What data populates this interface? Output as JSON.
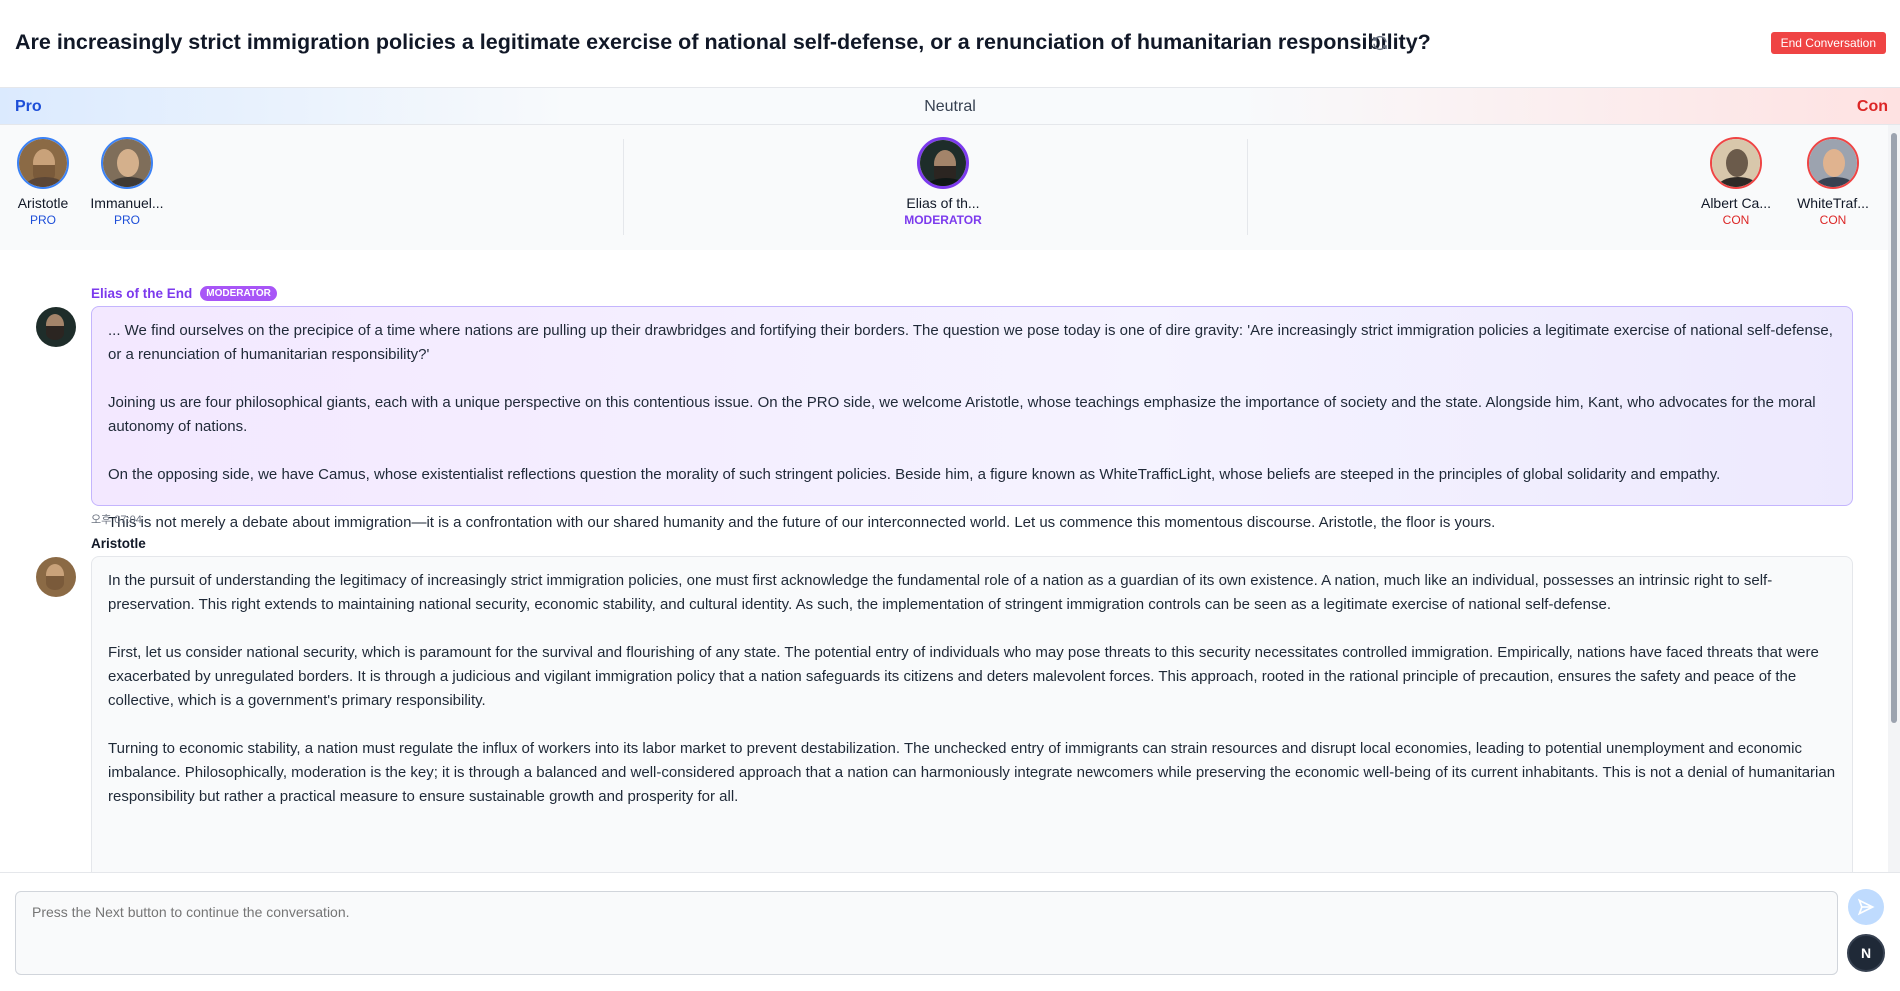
{
  "header": {
    "title": "Are increasingly strict immigration policies a legitimate exercise of national self-defense, or a renunciation of humanitarian responsibility?",
    "end_label": "End Conversation",
    "refresh_icon": "refresh-icon"
  },
  "stances": {
    "pro": "Pro",
    "neutral": "Neutral",
    "con": "Con"
  },
  "participants": [
    {
      "name": "Aristotle",
      "role": "PRO"
    },
    {
      "name": "Immanuel...",
      "role": "PRO"
    },
    {
      "name": "Elias of th...",
      "role": "MODERATOR"
    },
    {
      "name": "Albert Ca...",
      "role": "CON"
    },
    {
      "name": "WhiteTraf...",
      "role": "CON"
    }
  ],
  "messages": [
    {
      "name": "Elias of the End",
      "badge": "MODERATOR",
      "paragraphs": [
        "... We find ourselves on the precipice of a time where nations are pulling up their drawbridges and fortifying their borders. The question we pose today is one of dire gravity: 'Are increasingly strict immigration policies a legitimate exercise of national self-defense, or a renunciation of humanitarian responsibility?'",
        "Joining us are four philosophical giants, each with a unique perspective on this contentious issue. On the PRO side, we welcome Aristotle, whose teachings emphasize the importance of society and the state. Alongside him, Kant, who advocates for the moral autonomy of nations.",
        "On the opposing side, we have Camus, whose existentialist reflections question the morality of such stringent policies. Beside him, a figure known as WhiteTrafficLight, whose beliefs are steeped in the principles of global solidarity and empathy.",
        "This is not merely a debate about immigration—it is a confrontation with our shared humanity and the future of our interconnected world. Let us commence this momentous discourse. Aristotle, the floor is yours."
      ],
      "time": "오후 07:04"
    },
    {
      "name": "Aristotle",
      "paragraphs": [
        "In the pursuit of understanding the legitimacy of increasingly strict immigration policies, one must first acknowledge the fundamental role of a nation as a guardian of its own existence. A nation, much like an individual, possesses an intrinsic right to self-preservation. This right extends to maintaining national security, economic stability, and cultural identity. As such, the implementation of stringent immigration controls can be seen as a legitimate exercise of national self-defense.",
        "First, let us consider national security, which is paramount for the survival and flourishing of any state. The potential entry of individuals who may pose threats to this security necessitates controlled immigration. Empirically, nations have faced threats that were exacerbated by unregulated borders. It is through a judicious and vigilant immigration policy that a nation safeguards its citizens and deters malevolent forces. This approach, rooted in the rational principle of precaution, ensures the safety and peace of the collective, which is a government's primary responsibility.",
        "Turning to economic stability, a nation must regulate the influx of workers into its labor market to prevent destabilization. The unchecked entry of immigrants can strain resources and disrupt local economies, leading to potential unemployment and economic imbalance. Philosophically, moderation is the key; it is through a balanced and well-considered approach that a nation can harmoniously integrate newcomers while preserving the economic well-being of its current inhabitants. This is not a denial of humanitarian responsibility but rather a practical measure to ensure sustainable growth and prosperity for all."
      ]
    }
  ],
  "input": {
    "placeholder": "Press the Next button to continue the conversation.",
    "next_label": "N"
  },
  "colors": {
    "pro": "#1d4ed8",
    "con": "#dc2626",
    "moderator": "#7c3aed",
    "end_button": "#ef4444"
  }
}
